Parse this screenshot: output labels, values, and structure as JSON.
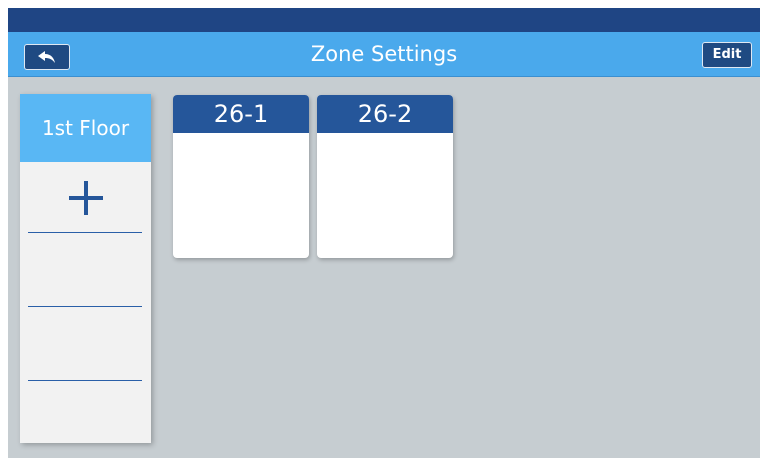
{
  "header": {
    "title": "Zone Settings",
    "back_icon": "back-arrow-icon",
    "edit_label": "Edit"
  },
  "floors": {
    "items": [
      {
        "label": "1st Floor",
        "selected": true
      }
    ],
    "add_icon": "plus-icon"
  },
  "zones": [
    {
      "label": "26-1"
    },
    {
      "label": "26-2"
    }
  ],
  "colors": {
    "status_bar": "#1f4584",
    "title_bar": "#4aa9ec",
    "button": "#1f4a82",
    "selected_floor": "#59b7f4",
    "zone_header": "#25569a",
    "background": "#c6cdd1"
  }
}
